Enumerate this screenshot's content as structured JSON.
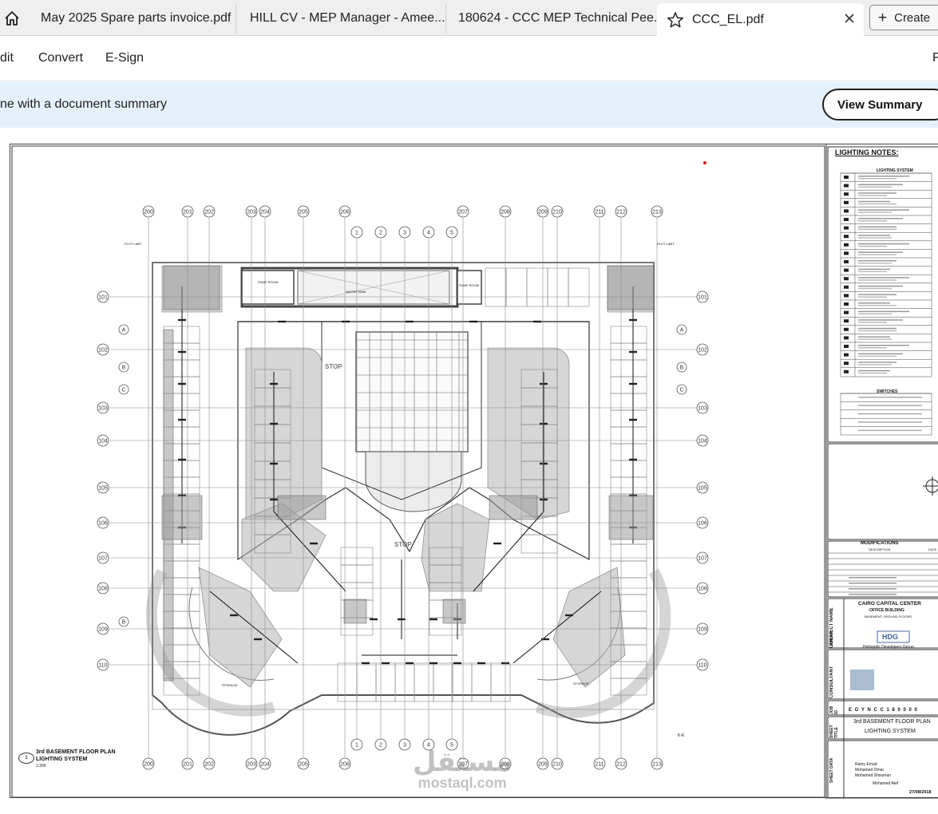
{
  "tabs": [
    {
      "label": "May 2025 Spare parts invoice.pdf"
    },
    {
      "label": "HILL CV - MEP Manager - Amee..."
    },
    {
      "label": "180624 - CCC MEP Technical Pee..."
    },
    {
      "label": "CCC_EL.pdf",
      "active": true
    }
  ],
  "create_label": "Create",
  "menu": [
    "dit",
    "Convert",
    "E-Sign",
    "F"
  ],
  "banner": {
    "text": "ne with a document summary",
    "button": "View Summary"
  },
  "drawing": {
    "plan_title": "3rd BASEMENT FLOOR  PLAN",
    "plan_subtitle": "LIGHTING SYSTEM",
    "plan_number": "1",
    "plan_scale": "1:300",
    "grid_top": [
      "200",
      "201",
      "202",
      "203",
      "204",
      "205",
      "206",
      "207",
      "208",
      "209",
      "210",
      "211",
      "212",
      "213"
    ],
    "grid_inner": [
      "1",
      "2",
      "3",
      "4",
      "5"
    ],
    "grid_left": [
      "101",
      "102",
      "103",
      "104",
      "105",
      "106",
      "107",
      "108",
      "109",
      "110"
    ],
    "grid_letters": [
      "A",
      "B",
      "C"
    ],
    "labels": {
      "water_tank": "WATER TANK",
      "pump_room": "PUMP ROOM",
      "stop": "STOP",
      "storage": "STORAGE",
      "plot_limit": "PLOT LIMIT",
      "kk": "K-K"
    }
  },
  "title_block": {
    "notes_title": "LIGHTING NOTES:",
    "legend_title": "LIGHTING SYSTEM",
    "switches_title": "SWITCHES",
    "modifications_title": "MODIFICATIONS",
    "mod_description": "DESCRIPTION",
    "mod_date": "DATE",
    "project_label": "PROJECT NAME",
    "project_name": "CAIRO CAPITAL CENTER",
    "project_sub": "OFFICE BUILDING",
    "project_sub2": "BASEMENT, GROUND FLOORS",
    "client_label": "CLIENT",
    "client_logo": "HDG",
    "client_name": "Heliopolis Developers Group",
    "consultant_label": "CONSULTANT",
    "job_label": "JOB ID",
    "job_code": "E G Y N C C 1 8 0 0 0 0",
    "sheet_title_label": "SHEET TITLE",
    "sheet_title_1": "3rd BASEMENT FLOOR  PLAN",
    "sheet_title_2": "LIGHTING SYSTEM",
    "sheet_data_label": "SHEET DATA",
    "designed_by": "Ramy Emad",
    "drawn_by_1": "Mohamed Omar",
    "drawn_by_2": "Mohamed Shouman",
    "checked_by": "Mohamed Atef",
    "plot_date": "27/08/2018"
  },
  "watermark": {
    "arabic": "مستقل",
    "latin": "mostaql.com"
  },
  "colors": {
    "banner_bg": "#e4f1fd",
    "tab_bg": "#efefef",
    "drawing_gray": "#9a9a9a"
  }
}
